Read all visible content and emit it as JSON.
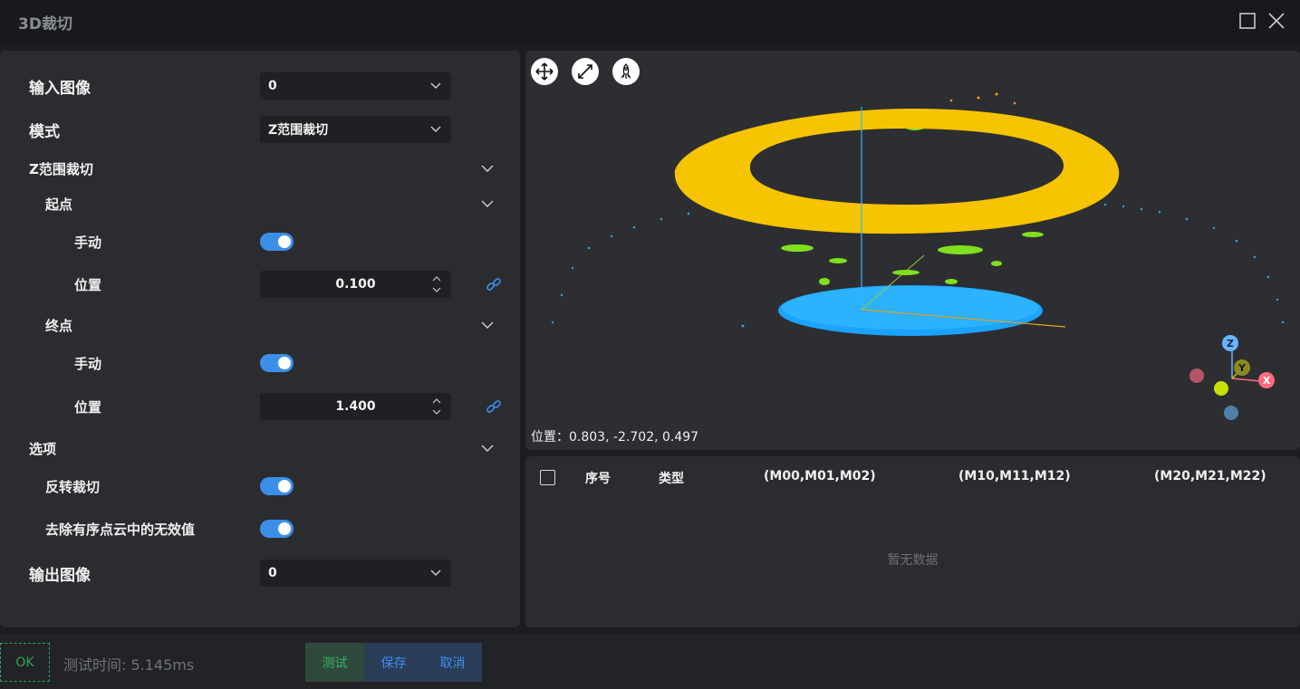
{
  "window": {
    "title": "3D裁切"
  },
  "form": {
    "input_image": {
      "label": "输入图像",
      "value": "0"
    },
    "mode": {
      "label": "模式",
      "value": "Z范围裁切"
    },
    "z_section": {
      "label": "Z范围裁切"
    },
    "start": {
      "label": "起点",
      "manual_label": "手动",
      "manual_on": true,
      "position_label": "位置",
      "position_value": "0.100"
    },
    "end": {
      "label": "终点",
      "manual_label": "手动",
      "manual_on": true,
      "position_label": "位置",
      "position_value": "1.400"
    },
    "options": {
      "label": "选项",
      "invert_label": "反转裁切",
      "invert_on": true,
      "remove_invalid_label": "去除有序点云中的无效值",
      "remove_invalid_on": true
    },
    "output_image": {
      "label": "输出图像",
      "value": "0"
    }
  },
  "viewer": {
    "position_text": "位置：0.803, -2.702, 0.497",
    "axes": {
      "z": "Z",
      "y": "Y",
      "x": "X"
    },
    "colors": {
      "ring": "#f6c400",
      "disk": "#1aa3ff",
      "scatter": "#33aadd",
      "green": "#7fe01e"
    }
  },
  "table": {
    "columns": [
      "序号",
      "类型",
      "(M00,M01,M02)",
      "(M10,M11,M12)",
      "(M20,M21,M22)"
    ],
    "rows": [],
    "empty_text": "暂无数据"
  },
  "footer": {
    "ok_label": "OK",
    "test_time": "测试时间: 5.145ms",
    "test_label": "测试",
    "save_label": "保存",
    "cancel_label": "取消"
  }
}
